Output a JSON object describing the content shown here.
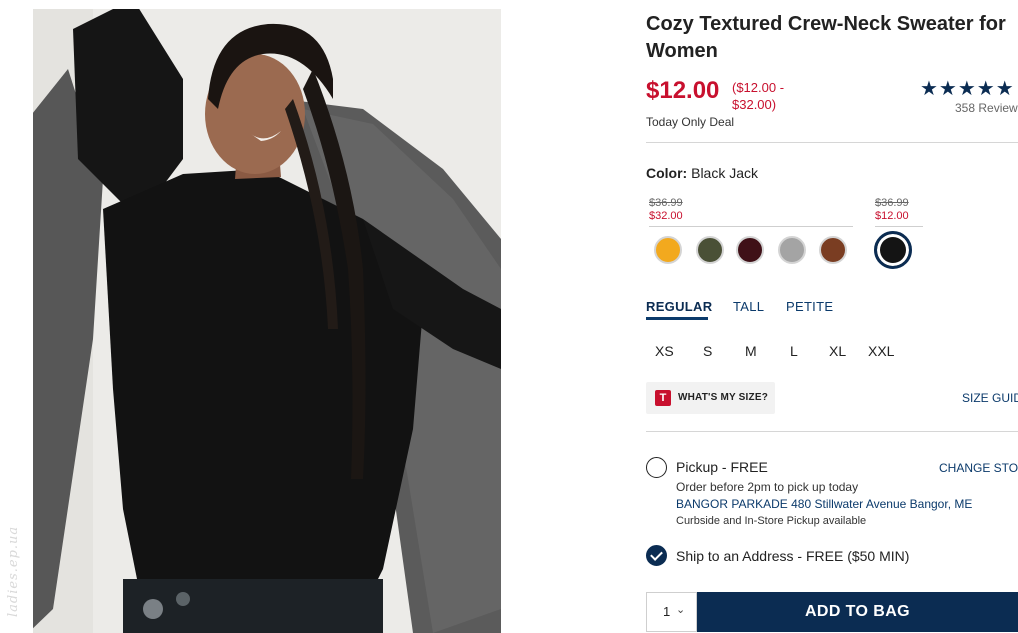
{
  "product": {
    "title_line1": "Cozy Textured Crew-Neck Sweater for",
    "title_line2": "Women",
    "price": "$12.00",
    "price_range_line1": "($12.00 -",
    "price_range_line2": "$32.00)",
    "deal_label": "Today Only Deal",
    "rating_stars": "★★★★★",
    "rating_value": 5,
    "review_count_label": "358 Review"
  },
  "color": {
    "label": "Color:",
    "selected_name": "Black Jack",
    "groups": [
      {
        "old_price": "$36.99",
        "new_price": "$32.00"
      },
      {
        "old_price": "$36.99",
        "new_price": "$12.00"
      }
    ],
    "swatches": [
      {
        "name": "swatch-mustard",
        "hex": "#f2a91e"
      },
      {
        "name": "swatch-olive",
        "hex": "#4a5036"
      },
      {
        "name": "swatch-burgundy",
        "hex": "#3f1017"
      },
      {
        "name": "swatch-gray",
        "hex": "#a4a4a4"
      },
      {
        "name": "swatch-brown",
        "hex": "#7a3d22"
      },
      {
        "name": "swatch-black-jack",
        "hex": "#141414",
        "selected": true
      }
    ]
  },
  "fit": {
    "tabs": [
      "REGULAR",
      "TALL",
      "PETITE"
    ],
    "active": "REGULAR"
  },
  "sizes": [
    "XS",
    "S",
    "M",
    "L",
    "XL",
    "XXL"
  ],
  "size_help": {
    "whats_my_size_logo": "T",
    "whats_my_size": "WHAT'S MY SIZE?",
    "size_guide": "SIZE GUIDI"
  },
  "fulfillment": {
    "pickup_label": "Pickup - FREE",
    "change_store": "CHANGE STORI",
    "order_note": "Order before 2pm to pick up today",
    "store_address": "BANGOR PARKADE 480 Stillwater Avenue  Bangor, ME",
    "curbside_note": "Curbside and In-Store Pickup available",
    "ship_label": "Ship to an Address - FREE ($50 MIN)",
    "ship_selected": true
  },
  "cart": {
    "quantity": "1",
    "add_to_bag": "ADD TO BAG"
  },
  "watermark": "ladies.ep.ua",
  "colors": {
    "brand_navy": "#0b2c52",
    "sale_red": "#c8102e",
    "link_blue": "#0b3a6b"
  }
}
